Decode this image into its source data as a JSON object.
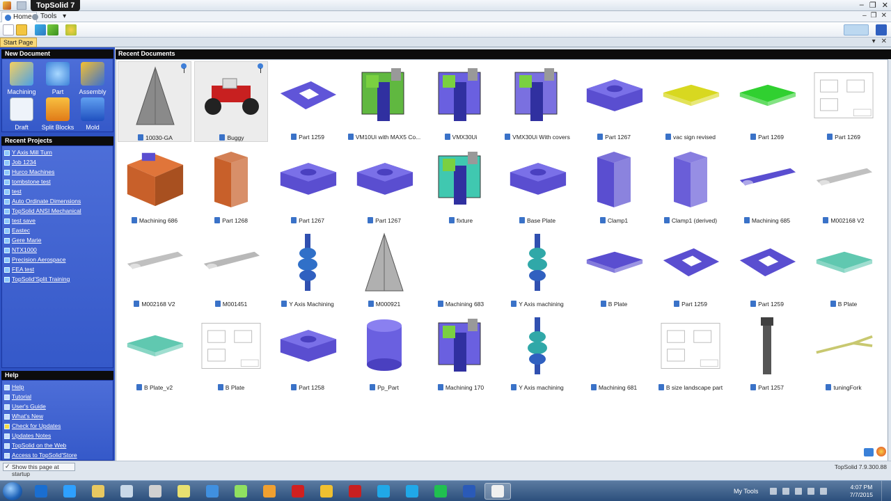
{
  "window": {
    "title": "TopSolid 7"
  },
  "ribbon": {
    "tabs": [
      {
        "label": "Home"
      },
      {
        "label": "Tools"
      }
    ]
  },
  "doc_tab": {
    "label": "Start Page"
  },
  "new_document": {
    "header": "New Document",
    "items": [
      {
        "label": "Machining",
        "icon": "machining-icon",
        "color": "#f0c040"
      },
      {
        "label": "Part",
        "icon": "part-icon",
        "color": "#4aa8f0"
      },
      {
        "label": "Assembly",
        "icon": "assembly-icon",
        "color": "#e8b020"
      },
      {
        "label": "Draft",
        "icon": "draft-icon",
        "color": "#e8eef6"
      },
      {
        "label": "Split Blocks",
        "icon": "split-blocks-icon",
        "color": "#f09020"
      },
      {
        "label": "Mold",
        "icon": "mold-icon",
        "color": "#3070d8"
      }
    ]
  },
  "recent_projects": {
    "header": "Recent Projects",
    "items": [
      "Y Axis Mill Turn",
      "Job 1234",
      "Hurco Machines",
      "tombstone test",
      "test",
      "Auto Ordinate Dimensions",
      "TopSolid ANSI Mechanical",
      "test save",
      "Eastec",
      "Gere Marie",
      "NTX1000",
      "Precision Aerospace",
      "FEA test",
      "TopSolid'Split Training"
    ]
  },
  "help": {
    "header": "Help",
    "items": [
      "Help",
      "Tutorial",
      "User's Guide",
      "What's New",
      "Check for Updates",
      "Updates Notes",
      "TopSolid on the Web",
      "Access to TopSolid'Store"
    ]
  },
  "recent_documents": {
    "header": "Recent Documents",
    "items": [
      {
        "label": "10030-GA",
        "pinned": true,
        "color": "#8a8a8a",
        "shape": "cone"
      },
      {
        "label": "Buggy",
        "pinned": true,
        "color": "#c82020",
        "shape": "car"
      },
      {
        "label": "Part 1259",
        "color": "#6055d8",
        "shape": "plate-hole"
      },
      {
        "label": "VM10Ui with MAX5 Co...",
        "color": "#60b840",
        "shape": "machine"
      },
      {
        "label": "VMX30Ui",
        "color": "#6a60e0",
        "shape": "machine"
      },
      {
        "label": "VMX30Ui With covers",
        "color": "#7a70e0",
        "shape": "machine"
      },
      {
        "label": "Part 1267",
        "color": "#5a4ed0",
        "shape": "block"
      },
      {
        "label": "vac sign revised",
        "color": "#d8d820",
        "shape": "flat"
      },
      {
        "label": "Part 1269",
        "color": "#30d030",
        "shape": "flat"
      },
      {
        "label": "Part 1269",
        "color": "#ffffff",
        "shape": "drawing"
      },
      {
        "label": "Machining 686",
        "color": "#c8602a",
        "shape": "cube"
      },
      {
        "label": "Part 1268",
        "color": "#c8602a",
        "shape": "tall"
      },
      {
        "label": "Part 1267",
        "color": "#5a4ed0",
        "shape": "block"
      },
      {
        "label": "Part 1267",
        "color": "#5a4ed0",
        "shape": "block"
      },
      {
        "label": "fixture",
        "color": "#40c8b0",
        "shape": "machine"
      },
      {
        "label": "Base Plate",
        "color": "#5a4ed0",
        "shape": "block"
      },
      {
        "label": "Clamp1",
        "color": "#5a4ed0",
        "shape": "tall"
      },
      {
        "label": "Clamp1 (derived)",
        "color": "#6a5ed8",
        "shape": "tall"
      },
      {
        "label": "Machining 685",
        "color": "#5a4ed0",
        "shape": "bar"
      },
      {
        "label": "M002168 V2",
        "color": "#c0c0c0",
        "shape": "bar"
      },
      {
        "label": "M002168 V2",
        "color": "#c0c0c0",
        "shape": "bar"
      },
      {
        "label": "M001451",
        "color": "#b8b8b8",
        "shape": "bar"
      },
      {
        "label": "Y Axis Machining",
        "color": "#3070c8",
        "shape": "shaft"
      },
      {
        "label": "M000921",
        "color": "#b0b0b0",
        "shape": "cone"
      },
      {
        "label": "Machining 683",
        "color": "#ffffff",
        "shape": "none"
      },
      {
        "label": "Y Axis machining",
        "color": "#30a8a8",
        "shape": "shaft"
      },
      {
        "label": "B Plate",
        "color": "#5a4ed0",
        "shape": "flat"
      },
      {
        "label": "Part 1259",
        "color": "#5a4ed0",
        "shape": "plate-hole"
      },
      {
        "label": "Part 1259",
        "color": "#5a4ed0",
        "shape": "plate-hole"
      },
      {
        "label": "B Plate",
        "color": "#60c8b0",
        "shape": "flat"
      },
      {
        "label": "B Plate_v2",
        "color": "#60c8b0",
        "shape": "flat"
      },
      {
        "label": "B Plate",
        "color": "#ffffff",
        "shape": "drawing"
      },
      {
        "label": "Part 1258",
        "color": "#5a4ed0",
        "shape": "block"
      },
      {
        "label": "Pp_Part",
        "color": "#6a60e0",
        "shape": "cylinder"
      },
      {
        "label": "Machining 170",
        "color": "#6a60e0",
        "shape": "machine"
      },
      {
        "label": "Y Axis machining",
        "color": "#30a8a8",
        "shape": "shaft"
      },
      {
        "label": "Machining 681",
        "color": "#ffffff",
        "shape": "none"
      },
      {
        "label": "B size landscape part",
        "color": "#ffffff",
        "shape": "drawing"
      },
      {
        "label": "Part 1257",
        "color": "#404040",
        "shape": "bolt"
      },
      {
        "label": "tuningFork",
        "color": "#c8c870",
        "shape": "fork"
      }
    ]
  },
  "footer": {
    "startup_label": "Show this page at startup",
    "version": "TopSolid 7.9.300.88"
  },
  "taskbar": {
    "mytools": "My Tools",
    "time": "4:07 PM",
    "date": "7/7/2015",
    "apps": [
      {
        "icon": "outlook-icon",
        "color": "#1a6ed0"
      },
      {
        "icon": "ie-icon",
        "color": "#2ea0ff"
      },
      {
        "icon": "explorer-icon",
        "color": "#e8c860"
      },
      {
        "icon": "magnifier-icon",
        "color": "#c8d8e8"
      },
      {
        "icon": "app-icon",
        "color": "#d0d0d0"
      },
      {
        "icon": "folder-icon",
        "color": "#e8e070"
      },
      {
        "icon": "translate-icon",
        "color": "#4090e0"
      },
      {
        "icon": "notes-icon",
        "color": "#90e060"
      },
      {
        "icon": "paint-icon",
        "color": "#f0a030"
      },
      {
        "icon": "acrobat-icon",
        "color": "#d02020"
      },
      {
        "icon": "pencil-icon",
        "color": "#f0c030"
      },
      {
        "icon": "filezilla-icon",
        "color": "#c82020"
      },
      {
        "icon": "skype-icon",
        "color": "#20a8e8"
      },
      {
        "icon": "skype-business-icon",
        "color": "#20a8e8"
      },
      {
        "icon": "spotify-icon",
        "color": "#20c050"
      },
      {
        "icon": "word-icon",
        "color": "#2a5ab8"
      },
      {
        "icon": "topsolid-icon",
        "color": "#f0f0f0"
      }
    ]
  }
}
